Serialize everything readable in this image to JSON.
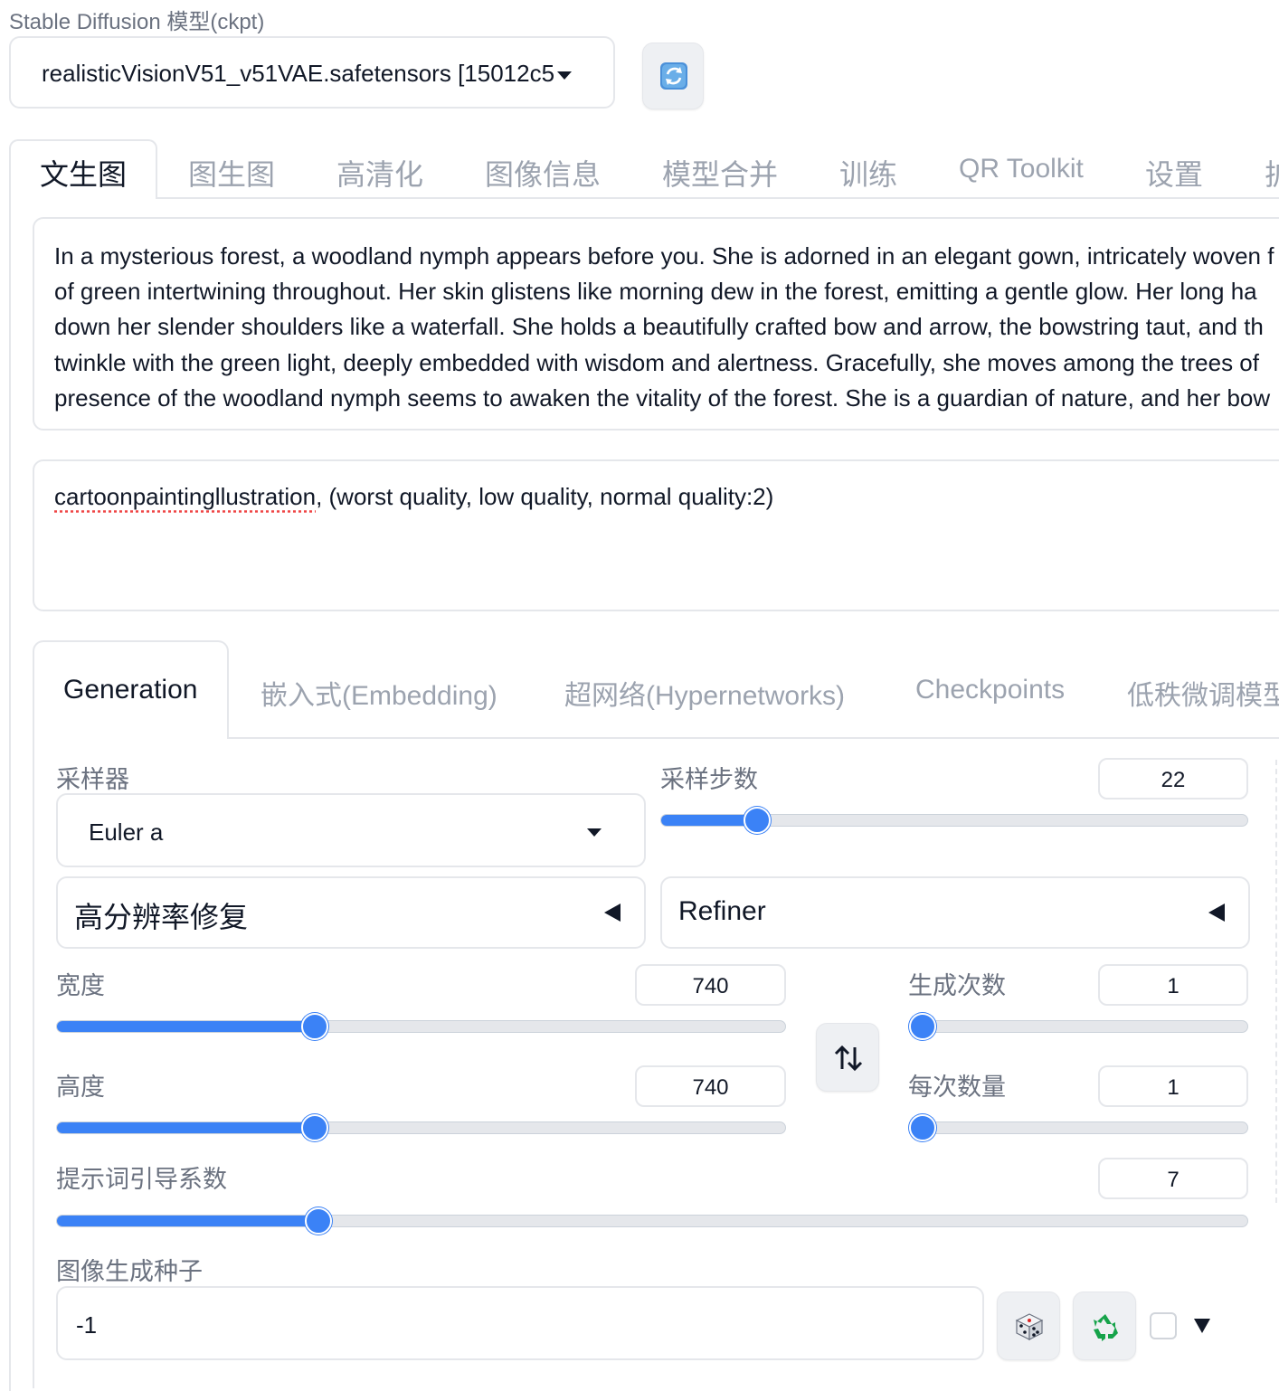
{
  "model": {
    "label": "Stable Diffusion 模型(ckpt)",
    "selected": "realisticVisionV51_v51VAE.safetensors [15012c5"
  },
  "top_tabs": [
    {
      "label": "文生图",
      "active": true
    },
    {
      "label": "图生图"
    },
    {
      "label": "高清化"
    },
    {
      "label": "图像信息"
    },
    {
      "label": "模型合并"
    },
    {
      "label": "训练"
    },
    {
      "label": "QR Toolkit"
    },
    {
      "label": "设置"
    },
    {
      "label": "扩"
    }
  ],
  "prompt": {
    "lines": [
      "In a mysterious forest, a woodland nymph appears before you. She is adorned in an elegant gown, intricately woven f",
      "of green intertwining throughout. Her skin glistens like morning dew in the forest, emitting a gentle glow. Her long ha",
      "down her slender shoulders like a waterfall. She holds a beautifully crafted bow and arrow, the bowstring taut, and th",
      "twinkle with the green light, deeply embedded with wisdom and alertness. Gracefully, she moves among the trees of",
      "presence of the woodland nymph seems to awaken the vitality of the forest. She is a guardian of nature, and her bow"
    ]
  },
  "negative_prompt": {
    "misspelled_word": "cartoonpaintingllustration",
    "rest": ", (worst quality, low quality, normal quality:2)"
  },
  "inner_tabs": [
    {
      "label": "Generation",
      "active": true
    },
    {
      "label": "嵌入式(Embedding)"
    },
    {
      "label": "超网络(Hypernetworks)"
    },
    {
      "label": "Checkpoints"
    },
    {
      "label": "低秩微调模型"
    }
  ],
  "sampler": {
    "label": "采样器",
    "value": "Euler a"
  },
  "steps": {
    "label": "采样步数",
    "value": "22",
    "fraction": 0.148
  },
  "hires": {
    "label": "高分辨率修复"
  },
  "refiner": {
    "label": "Refiner"
  },
  "width": {
    "label": "宽度",
    "value": "740",
    "fraction": 0.349
  },
  "height": {
    "label": "高度",
    "value": "740",
    "fraction": 0.349
  },
  "batch_count": {
    "label": "生成次数",
    "value": "1",
    "fraction": 0.0
  },
  "batch_size": {
    "label": "每次数量",
    "value": "1",
    "fraction": 0.0
  },
  "cfg": {
    "label": "提示词引导系数",
    "value": "7",
    "fraction": 0.213
  },
  "seed": {
    "label": "图像生成种子",
    "value": "-1"
  },
  "colors": {
    "accent": "#3b82f6",
    "border": "#e5e7eb",
    "muted_text": "#9ca3af"
  },
  "icons": {
    "refresh": "refresh-icon",
    "swap": "swap-dimensions-icon",
    "dice": "dice-icon",
    "recycle": "recycle-icon"
  }
}
